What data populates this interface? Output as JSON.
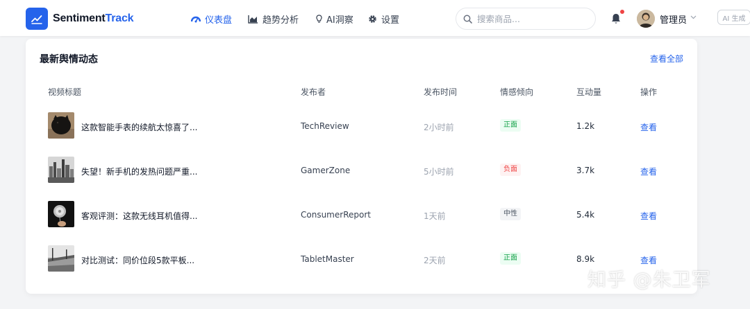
{
  "app": {
    "logo_primary": "Sentiment",
    "logo_accent": "Track",
    "brand_color": "#2563eb"
  },
  "nav": {
    "items": [
      {
        "label": "仪表盘",
        "icon": "dashboard-icon",
        "active": true
      },
      {
        "label": "趋势分析",
        "icon": "area-chart-icon",
        "active": false
      },
      {
        "label": "AI洞察",
        "icon": "lightbulb-icon",
        "active": false
      },
      {
        "label": "设置",
        "icon": "gear-icon",
        "active": false
      }
    ]
  },
  "search": {
    "placeholder": "搜索商品...",
    "value": ""
  },
  "user": {
    "name": "管理员",
    "has_notification": true
  },
  "ai_badge": "AI 生成",
  "card": {
    "title": "最新舆情动态",
    "view_all": "查看全部",
    "columns": [
      "视频标题",
      "发布者",
      "发布时间",
      "情感倾向",
      "互动量",
      "操作"
    ],
    "rows": [
      {
        "title": "这款智能手表的续航太惊喜了...",
        "publisher": "TechReview",
        "time": "2小时前",
        "sentiment": "正面",
        "sentiment_type": "positive",
        "interactions": "1.2k",
        "action": "查看",
        "thumb": "dark-cat-thumbnail"
      },
      {
        "title": "失望！新手机的发热问题严重...",
        "publisher": "GamerZone",
        "time": "5小时前",
        "sentiment": "负面",
        "sentiment_type": "negative",
        "interactions": "3.7k",
        "action": "查看",
        "thumb": "city-skyline-thumbnail"
      },
      {
        "title": "客观评测：这款无线耳机值得...",
        "publisher": "ConsumerReport",
        "time": "1天前",
        "sentiment": "中性",
        "sentiment_type": "neutral",
        "interactions": "5.4k",
        "action": "查看",
        "thumb": "dandelion-thumbnail"
      },
      {
        "title": "对比测试：同价位段5款平板...",
        "publisher": "TabletMaster",
        "time": "2天前",
        "sentiment": "正面",
        "sentiment_type": "positive",
        "interactions": "8.9k",
        "action": "查看",
        "thumb": "grayscale-landscape-thumbnail"
      }
    ]
  },
  "watermark": "知乎 @朱卫军"
}
